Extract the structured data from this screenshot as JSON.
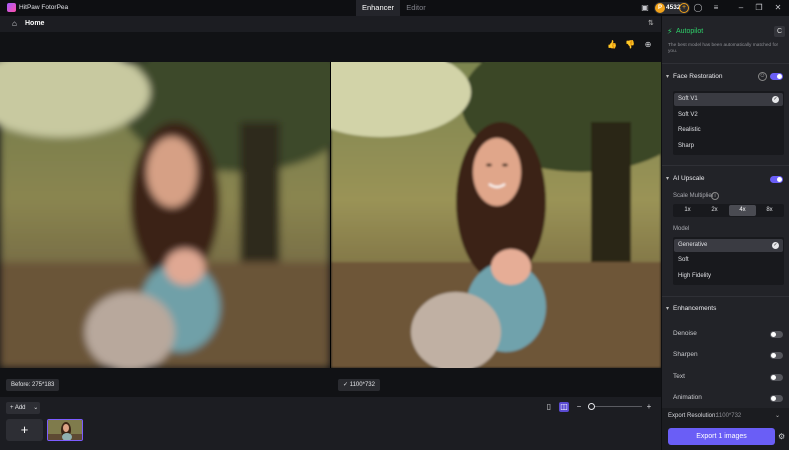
{
  "app": {
    "title": "HitPaw FotorPea"
  },
  "tabs": [
    {
      "label": "Enhancer",
      "active": true
    },
    {
      "label": "Editor",
      "active": false
    }
  ],
  "credits": {
    "count": "4532"
  },
  "breadcrumb": {
    "home": "Home"
  },
  "canvas": {
    "before_label": "Before: 275*183",
    "after_label": "1100*732"
  },
  "bottom": {
    "add_label": "Add"
  },
  "panel": {
    "autopilot": {
      "label": "Autopilot",
      "subtitle": "The best model has been automatically matched for you."
    },
    "face_restoration": {
      "title": "Face Restoration",
      "enabled": true,
      "options": [
        "Soft V1",
        "Soft V2",
        "Realistic",
        "Sharp"
      ],
      "selected": "Soft V1"
    },
    "ai_upscale": {
      "title": "AI Upscale",
      "enabled": true,
      "scale_label": "Scale Multiplier",
      "scales": [
        "1x",
        "2x",
        "4x",
        "8x"
      ],
      "selected_scale": "4x",
      "model_label": "Model",
      "models": [
        "Generative",
        "Soft",
        "High Fidelity"
      ],
      "selected_model": "Generative"
    },
    "enhancements": {
      "title": "Enhancements",
      "items": [
        {
          "label": "Denoise",
          "enabled": false
        },
        {
          "label": "Sharpen",
          "enabled": false
        },
        {
          "label": "Text",
          "enabled": false
        },
        {
          "label": "Animation",
          "enabled": false
        }
      ]
    },
    "export": {
      "resolution_label": "Export Resolution:",
      "resolution_value": "1100*732",
      "button": "Export 1 images"
    }
  },
  "colors": {
    "accent": "#6a5ef6",
    "coin": "#f0a21b",
    "autopilot": "#2fd06a"
  }
}
